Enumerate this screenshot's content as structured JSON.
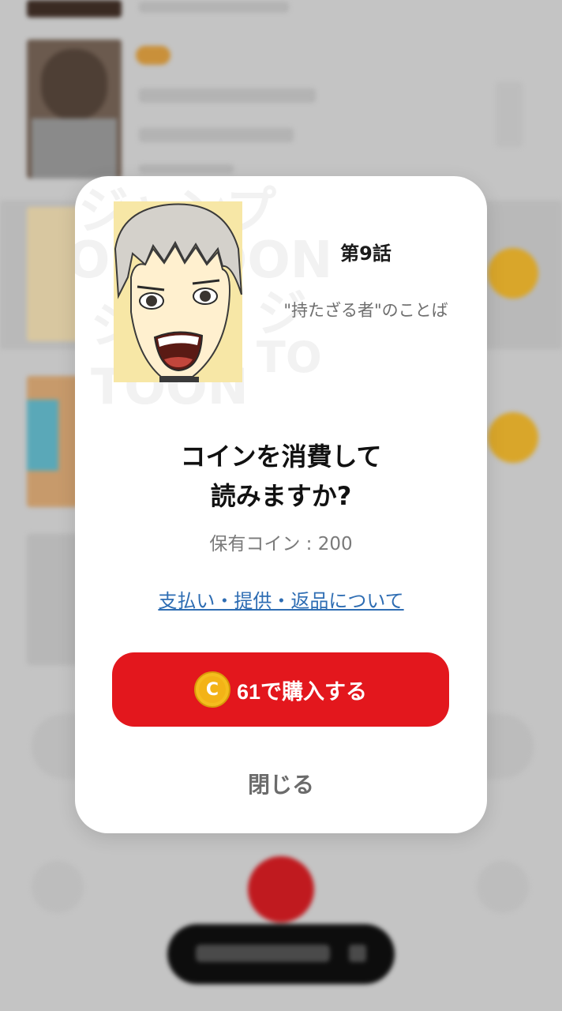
{
  "modal": {
    "episode_number": "第9話",
    "episode_title": "\"持たざる者\"のことば",
    "question_lines": [
      "コインを消費して",
      "読みますか?"
    ],
    "owned_coins": "保有コイン : 200",
    "policy_link": "支払い・提供・返品について",
    "buy_button": {
      "coin_symbol": "C",
      "label": "61で購入する"
    },
    "close_button": "閉じる"
  },
  "colors": {
    "accent": "#e3171d",
    "coin": "#f5bd1e",
    "link": "#2e6db3"
  }
}
